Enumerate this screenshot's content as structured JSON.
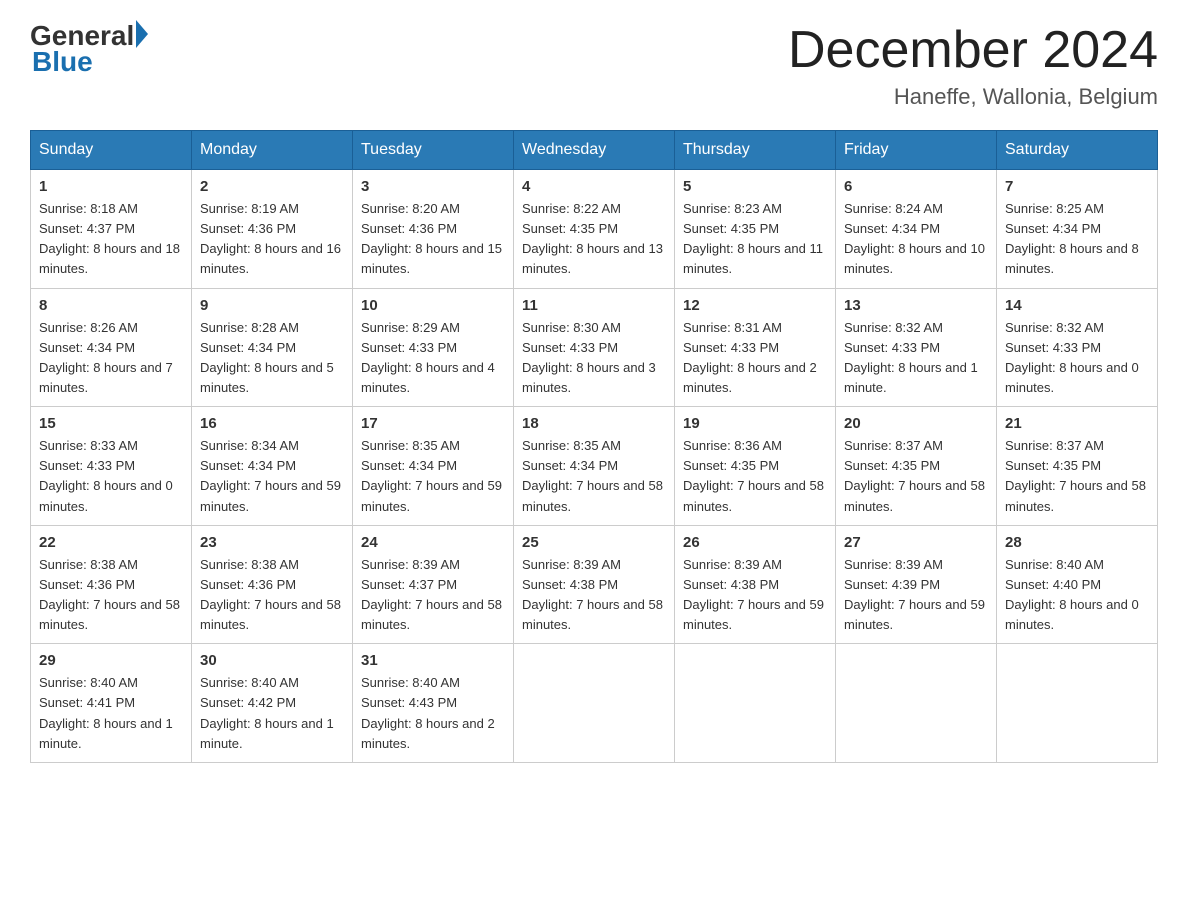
{
  "header": {
    "logo_general": "General",
    "logo_blue": "Blue",
    "month_title": "December 2024",
    "location": "Haneffe, Wallonia, Belgium"
  },
  "days_header": [
    "Sunday",
    "Monday",
    "Tuesday",
    "Wednesday",
    "Thursday",
    "Friday",
    "Saturday"
  ],
  "weeks": [
    {
      "row_class": "row-odd",
      "days": [
        {
          "num": "1",
          "sunrise": "8:18 AM",
          "sunset": "4:37 PM",
          "daylight": "8 hours and 18 minutes."
        },
        {
          "num": "2",
          "sunrise": "8:19 AM",
          "sunset": "4:36 PM",
          "daylight": "8 hours and 16 minutes."
        },
        {
          "num": "3",
          "sunrise": "8:20 AM",
          "sunset": "4:36 PM",
          "daylight": "8 hours and 15 minutes."
        },
        {
          "num": "4",
          "sunrise": "8:22 AM",
          "sunset": "4:35 PM",
          "daylight": "8 hours and 13 minutes."
        },
        {
          "num": "5",
          "sunrise": "8:23 AM",
          "sunset": "4:35 PM",
          "daylight": "8 hours and 11 minutes."
        },
        {
          "num": "6",
          "sunrise": "8:24 AM",
          "sunset": "4:34 PM",
          "daylight": "8 hours and 10 minutes."
        },
        {
          "num": "7",
          "sunrise": "8:25 AM",
          "sunset": "4:34 PM",
          "daylight": "8 hours and 8 minutes."
        }
      ]
    },
    {
      "row_class": "row-even",
      "days": [
        {
          "num": "8",
          "sunrise": "8:26 AM",
          "sunset": "4:34 PM",
          "daylight": "8 hours and 7 minutes."
        },
        {
          "num": "9",
          "sunrise": "8:28 AM",
          "sunset": "4:34 PM",
          "daylight": "8 hours and 5 minutes."
        },
        {
          "num": "10",
          "sunrise": "8:29 AM",
          "sunset": "4:33 PM",
          "daylight": "8 hours and 4 minutes."
        },
        {
          "num": "11",
          "sunrise": "8:30 AM",
          "sunset": "4:33 PM",
          "daylight": "8 hours and 3 minutes."
        },
        {
          "num": "12",
          "sunrise": "8:31 AM",
          "sunset": "4:33 PM",
          "daylight": "8 hours and 2 minutes."
        },
        {
          "num": "13",
          "sunrise": "8:32 AM",
          "sunset": "4:33 PM",
          "daylight": "8 hours and 1 minute."
        },
        {
          "num": "14",
          "sunrise": "8:32 AM",
          "sunset": "4:33 PM",
          "daylight": "8 hours and 0 minutes."
        }
      ]
    },
    {
      "row_class": "row-odd",
      "days": [
        {
          "num": "15",
          "sunrise": "8:33 AM",
          "sunset": "4:33 PM",
          "daylight": "8 hours and 0 minutes."
        },
        {
          "num": "16",
          "sunrise": "8:34 AM",
          "sunset": "4:34 PM",
          "daylight": "7 hours and 59 minutes."
        },
        {
          "num": "17",
          "sunrise": "8:35 AM",
          "sunset": "4:34 PM",
          "daylight": "7 hours and 59 minutes."
        },
        {
          "num": "18",
          "sunrise": "8:35 AM",
          "sunset": "4:34 PM",
          "daylight": "7 hours and 58 minutes."
        },
        {
          "num": "19",
          "sunrise": "8:36 AM",
          "sunset": "4:35 PM",
          "daylight": "7 hours and 58 minutes."
        },
        {
          "num": "20",
          "sunrise": "8:37 AM",
          "sunset": "4:35 PM",
          "daylight": "7 hours and 58 minutes."
        },
        {
          "num": "21",
          "sunrise": "8:37 AM",
          "sunset": "4:35 PM",
          "daylight": "7 hours and 58 minutes."
        }
      ]
    },
    {
      "row_class": "row-even",
      "days": [
        {
          "num": "22",
          "sunrise": "8:38 AM",
          "sunset": "4:36 PM",
          "daylight": "7 hours and 58 minutes."
        },
        {
          "num": "23",
          "sunrise": "8:38 AM",
          "sunset": "4:36 PM",
          "daylight": "7 hours and 58 minutes."
        },
        {
          "num": "24",
          "sunrise": "8:39 AM",
          "sunset": "4:37 PM",
          "daylight": "7 hours and 58 minutes."
        },
        {
          "num": "25",
          "sunrise": "8:39 AM",
          "sunset": "4:38 PM",
          "daylight": "7 hours and 58 minutes."
        },
        {
          "num": "26",
          "sunrise": "8:39 AM",
          "sunset": "4:38 PM",
          "daylight": "7 hours and 59 minutes."
        },
        {
          "num": "27",
          "sunrise": "8:39 AM",
          "sunset": "4:39 PM",
          "daylight": "7 hours and 59 minutes."
        },
        {
          "num": "28",
          "sunrise": "8:40 AM",
          "sunset": "4:40 PM",
          "daylight": "8 hours and 0 minutes."
        }
      ]
    },
    {
      "row_class": "row-odd",
      "days": [
        {
          "num": "29",
          "sunrise": "8:40 AM",
          "sunset": "4:41 PM",
          "daylight": "8 hours and 1 minute."
        },
        {
          "num": "30",
          "sunrise": "8:40 AM",
          "sunset": "4:42 PM",
          "daylight": "8 hours and 1 minute."
        },
        {
          "num": "31",
          "sunrise": "8:40 AM",
          "sunset": "4:43 PM",
          "daylight": "8 hours and 2 minutes."
        },
        null,
        null,
        null,
        null
      ]
    }
  ],
  "labels": {
    "sunrise_prefix": "Sunrise: ",
    "sunset_prefix": "Sunset: ",
    "daylight_prefix": "Daylight: "
  }
}
